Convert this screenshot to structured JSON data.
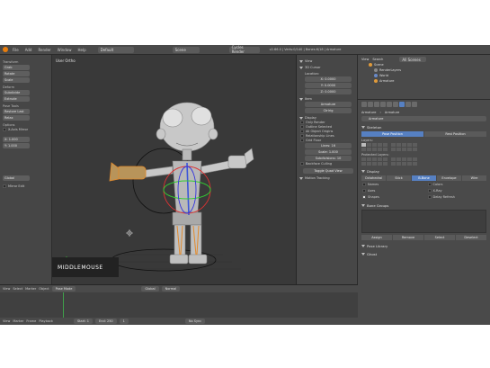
{
  "header": {
    "menus": [
      "File",
      "Add",
      "Render",
      "Window",
      "Help"
    ],
    "layout": "Default",
    "scene": "Scene",
    "engine": "Cycles Render",
    "info": "v2.66.0 | Verts:0/140 | Bones:6/18 | Armature"
  },
  "tool_shelf": {
    "transform_title": "Transform",
    "transform_buttons": [
      "Grab",
      "Rotate",
      "Scale"
    ],
    "deform_title": "Deform",
    "deform_buttons": [
      "Subdivide",
      "Extrude"
    ],
    "pose_title": "Pose Tools",
    "pose_buttons": [
      "Restore Last",
      "Relax"
    ],
    "options_title": "Options",
    "x_axis_mirror": "X-Axis Mirror",
    "fields": [
      "X: 1.000",
      "Y: 1.000"
    ],
    "orient": "Global",
    "mirror_edit": "Mirror Edit"
  },
  "viewport": {
    "view_label": "User Ortho",
    "object_label": "(1) Armature Ctrlrig",
    "overlay_text": "MIDDLEMOUSE"
  },
  "n_panel": {
    "view_title": "View",
    "transform_title": "3D Cursor",
    "location_title": "Location:",
    "location": [
      "X: 0.0000",
      "Y: 0.0000",
      "Z: 0.0000"
    ],
    "item_title": "Item",
    "item_fields": [
      "Armature",
      "Ctrlrig"
    ],
    "display_title": "Display",
    "display_checks": [
      "Only Render",
      "Outline Selected",
      "All Object Origins",
      "Relationship Lines",
      "Grid Floor"
    ],
    "grid_fields": [
      "Lines: 16",
      "Scale: 1.000",
      "Subdivisions: 10"
    ],
    "backface": "Backface Culling",
    "quad_view": "Toggle Quad View",
    "motion_tracking": "Motion Tracking"
  },
  "outliner": {
    "header": [
      "View",
      "Search",
      "All Scenes"
    ],
    "rows": [
      "Scene",
      "RenderLayers",
      "World",
      "Armature"
    ]
  },
  "properties": {
    "context": [
      "Armature",
      "Armature"
    ],
    "name_field": "Armature",
    "skeleton_title": "Skeleton",
    "position_buttons": [
      "Pose Position",
      "Rest Position"
    ],
    "layers_label": "Layers:",
    "protected_label": "Protected Layers:",
    "display_title": "Display",
    "display_types": [
      "Octahedral",
      "Stick",
      "B-Bone",
      "Envelope",
      "Wire"
    ],
    "display_checks": [
      "Names",
      "Colors",
      "Axes",
      "X-Ray",
      "Shapes",
      "Delay Refresh"
    ],
    "bone_groups_title": "Bone Groups",
    "bg_buttons": [
      "Assign",
      "Remove",
      "Select",
      "Deselect"
    ],
    "pose_library_title": "Pose Library",
    "ghost_title": "Ghost"
  },
  "timeline": {
    "header_items": [
      "View",
      "Select",
      "Marker",
      "Object",
      "Pose Mode",
      "Global",
      "Normal"
    ],
    "ruler": [
      "-40",
      "-20",
      "0",
      "20",
      "40",
      "60",
      "80",
      "100",
      "120",
      "140",
      "160",
      "180",
      "200",
      "220",
      "240",
      "260"
    ],
    "footer_items": [
      "View",
      "Marker",
      "Frame",
      "Playback"
    ],
    "start": "Start: 1",
    "end": "End: 250",
    "current": "1",
    "sync": "No Sync"
  }
}
